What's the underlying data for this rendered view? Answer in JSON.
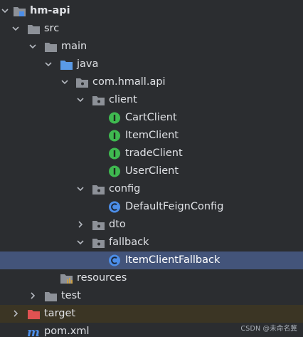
{
  "tree": {
    "nodes": [
      {
        "label": "hm-api",
        "kind": "module",
        "expanded": true,
        "depth": 0
      },
      {
        "label": "src",
        "kind": "folder",
        "expanded": true,
        "depth": 1
      },
      {
        "label": "main",
        "kind": "folder",
        "expanded": true,
        "depth": 2
      },
      {
        "label": "java",
        "kind": "source-folder",
        "expanded": true,
        "depth": 3
      },
      {
        "label": "com.hmall.api",
        "kind": "package",
        "expanded": true,
        "depth": 4
      },
      {
        "label": "client",
        "kind": "package",
        "expanded": true,
        "depth": 5
      },
      {
        "label": "CartClient",
        "kind": "interface",
        "depth": 6
      },
      {
        "label": "ItemClient",
        "kind": "interface",
        "depth": 6
      },
      {
        "label": "tradeClient",
        "kind": "interface",
        "depth": 6
      },
      {
        "label": "UserClient",
        "kind": "interface",
        "depth": 6
      },
      {
        "label": "config",
        "kind": "package",
        "expanded": true,
        "depth": 5
      },
      {
        "label": "DefaultFeignConfig",
        "kind": "class",
        "depth": 6
      },
      {
        "label": "dto",
        "kind": "package",
        "expanded": false,
        "depth": 5
      },
      {
        "label": "fallback",
        "kind": "package",
        "expanded": true,
        "depth": 5
      },
      {
        "label": "ItemClientFallback",
        "kind": "class",
        "depth": 6,
        "selected": true
      },
      {
        "label": "resources",
        "kind": "resources-folder",
        "depth": 3
      },
      {
        "label": "test",
        "kind": "folder",
        "expanded": false,
        "depth": 2
      },
      {
        "label": "target",
        "kind": "excluded-folder",
        "expanded": false,
        "depth": 1
      },
      {
        "label": "pom.xml",
        "kind": "maven-file",
        "depth": 1
      }
    ]
  },
  "watermark": "CSDN @未命名冀",
  "colors": {
    "background": "#2b2d30",
    "selection": "#43547a",
    "excluded_row": "#3b3524",
    "interface_icon": "#3fb950",
    "class_icon": "#4c8ee8",
    "source_folder": "#5a9ae6",
    "target_folder": "#e05252",
    "folder": "#8d9198"
  }
}
